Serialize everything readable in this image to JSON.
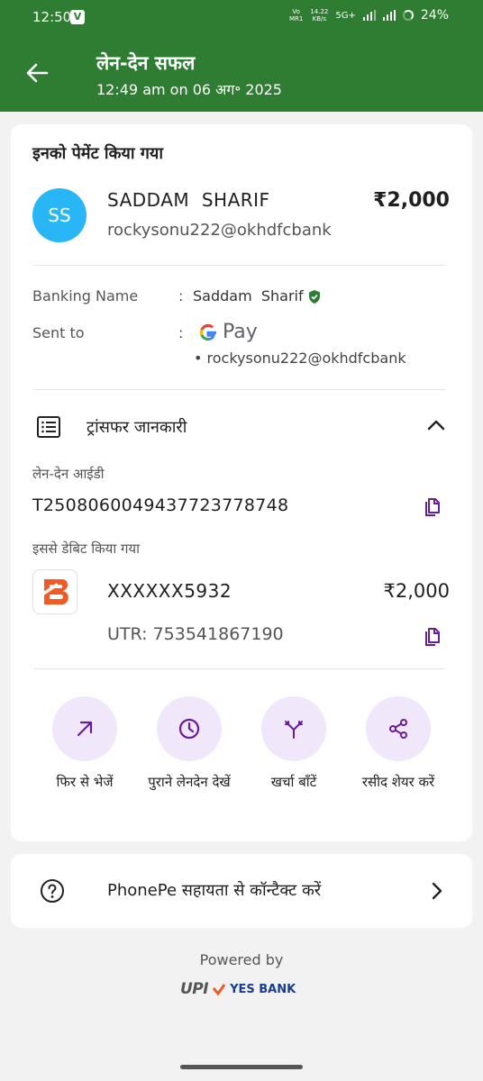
{
  "status_bar": {
    "time": "12:50",
    "app_badge": "V",
    "network_small": "Vo\nMR1",
    "speed": "14.22\nKB/s",
    "net_type": "5G+",
    "battery": "24%"
  },
  "header": {
    "title": "लेन-देन सफल",
    "subtitle": "12:49 am on 06 अग॰ 2025",
    "bg_color": "#2e7d32"
  },
  "payment": {
    "heading": "इनको पेमेंट किया गया",
    "avatar_initials": "SS",
    "payee_name": "SADDAM  SHARIF",
    "payee_upi": "rockysonu222@okhdfcbank",
    "amount": "₹2,000"
  },
  "details": {
    "banking_name_label": "Banking Name",
    "banking_name_value": "Saddam  Sharif",
    "sent_to_label": "Sent to",
    "colon": ":",
    "gpay_label": "Pay",
    "sent_to_upi": "• rockysonu222@okhdfcbank"
  },
  "transfer": {
    "title": "ट्रांसफर जानकारी",
    "txn_id_label": "लेन-देन आईडी",
    "txn_id": "T2508060049437723778748",
    "debited_label": "इससे डेबिट किया गया",
    "account": "XXXXXX5932",
    "account_amount": "₹2,000",
    "utr": "UTR: 753541867190"
  },
  "actions": [
    {
      "label": "फिर से भेजें",
      "icon": "arrow-up-right-icon"
    },
    {
      "label": "पुराने लेनदेन देखें",
      "icon": "clock-icon"
    },
    {
      "label": "खर्चा बाँटें",
      "icon": "split-icon"
    },
    {
      "label": "रसीद शेयर करें",
      "icon": "share-icon"
    }
  ],
  "help": {
    "text": "PhonePe सहायता से कॉन्टैक्ट करें"
  },
  "footer": {
    "powered_by": "Powered by",
    "upi_text": "UPI",
    "bank_text": "YES BANK"
  },
  "colors": {
    "accent_purple": "#6a1b9a",
    "action_bg": "#f1e7fb",
    "verified_green": "#2e7d32"
  }
}
